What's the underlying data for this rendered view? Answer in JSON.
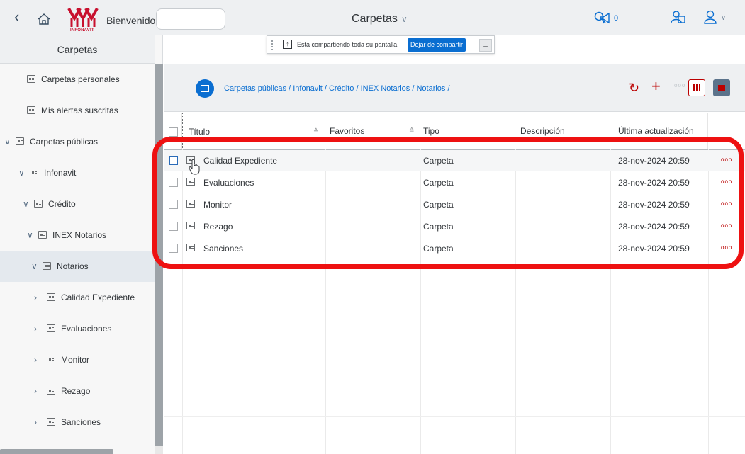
{
  "shell": {
    "welcome_label": "Bienvenido:",
    "logo_text": "INFONAVIT",
    "title": "Carpetas",
    "title_chevron": "∨",
    "notifications_count": "0"
  },
  "share_bar": {
    "text": "Está compartiendo toda su pantalla.",
    "stop_label": "Dejar de compartir",
    "minimize_label": "_"
  },
  "sidebar": {
    "header": "Carpetas",
    "items": [
      {
        "label": "Carpetas personales",
        "chevron": ""
      },
      {
        "label": "Mis alertas suscritas",
        "chevron": ""
      },
      {
        "label": "Carpetas públicas",
        "chevron": "∨"
      },
      {
        "label": "Infonavit",
        "chevron": "∨"
      },
      {
        "label": "Crédito",
        "chevron": "∨"
      },
      {
        "label": "INEX Notarios",
        "chevron": "∨"
      },
      {
        "label": "Notarios",
        "chevron": "∨"
      },
      {
        "label": "Calidad Expediente",
        "chevron": "›"
      },
      {
        "label": "Evaluaciones",
        "chevron": "›"
      },
      {
        "label": "Monitor",
        "chevron": "›"
      },
      {
        "label": "Rezago",
        "chevron": "›"
      },
      {
        "label": "Sanciones",
        "chevron": "›"
      }
    ]
  },
  "main": {
    "breadcrumb": "Carpetas públicas / Infonavit / Crédito / INEX Notarios / Notarios /",
    "toolbar_dots": "ooo",
    "columns": {
      "title": "Título",
      "favorites": "Favoritos",
      "type": "Tipo",
      "description": "Descripción",
      "updated": "Última actualización"
    },
    "rows": [
      {
        "title": "Calidad Expediente",
        "type": "Carpeta",
        "updated": "28-nov-2024 20:59",
        "dots": "ooo"
      },
      {
        "title": "Evaluaciones",
        "type": "Carpeta",
        "updated": "28-nov-2024 20:59",
        "dots": "ooo"
      },
      {
        "title": "Monitor",
        "type": "Carpeta",
        "updated": "28-nov-2024 20:59",
        "dots": "ooo"
      },
      {
        "title": "Rezago",
        "type": "Carpeta",
        "updated": "28-nov-2024 20:59",
        "dots": "ooo"
      },
      {
        "title": "Sanciones",
        "type": "Carpeta",
        "updated": "28-nov-2024 20:59",
        "dots": "ooo"
      }
    ]
  },
  "colors": {
    "accent": "#0a6ed1",
    "highlight": "#ee1111",
    "action_red": "#bb0000"
  }
}
